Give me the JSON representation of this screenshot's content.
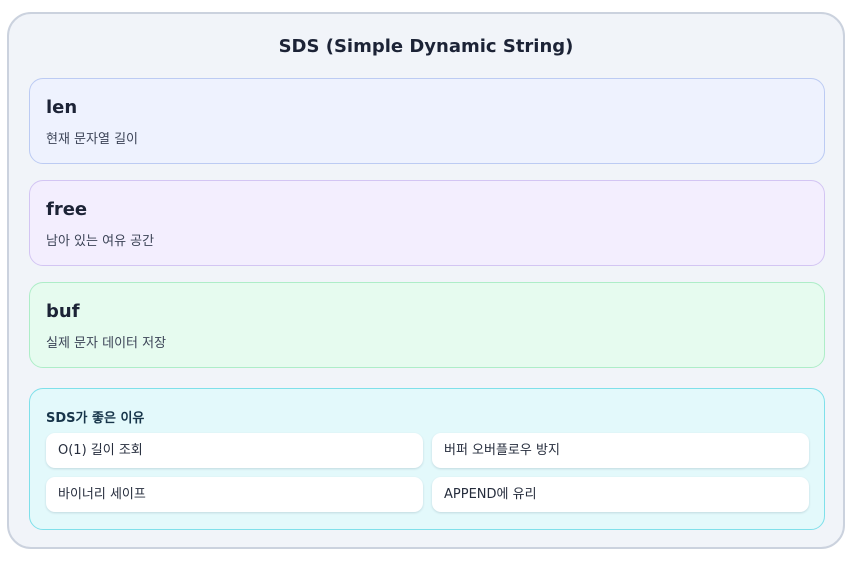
{
  "title": "SDS (Simple Dynamic String)",
  "fields": [
    {
      "name": "len",
      "desc": "현재 문자열 길이"
    },
    {
      "name": "free",
      "desc": "남아 있는 여유 공간"
    },
    {
      "name": "buf",
      "desc": "실제 문자 데이터 저장"
    }
  ],
  "benefits": {
    "title": "SDS가 좋은 이유",
    "items": [
      "O(1) 길이 조회",
      "버퍼 오버플로우 방지",
      "바이너리 세이프",
      "APPEND에 유리"
    ]
  },
  "colors": {
    "len_bg": "#eef2fe",
    "free_bg": "#f3eefe",
    "buf_bg": "#e6fbef",
    "benefits_bg": "#e3f9fb"
  }
}
